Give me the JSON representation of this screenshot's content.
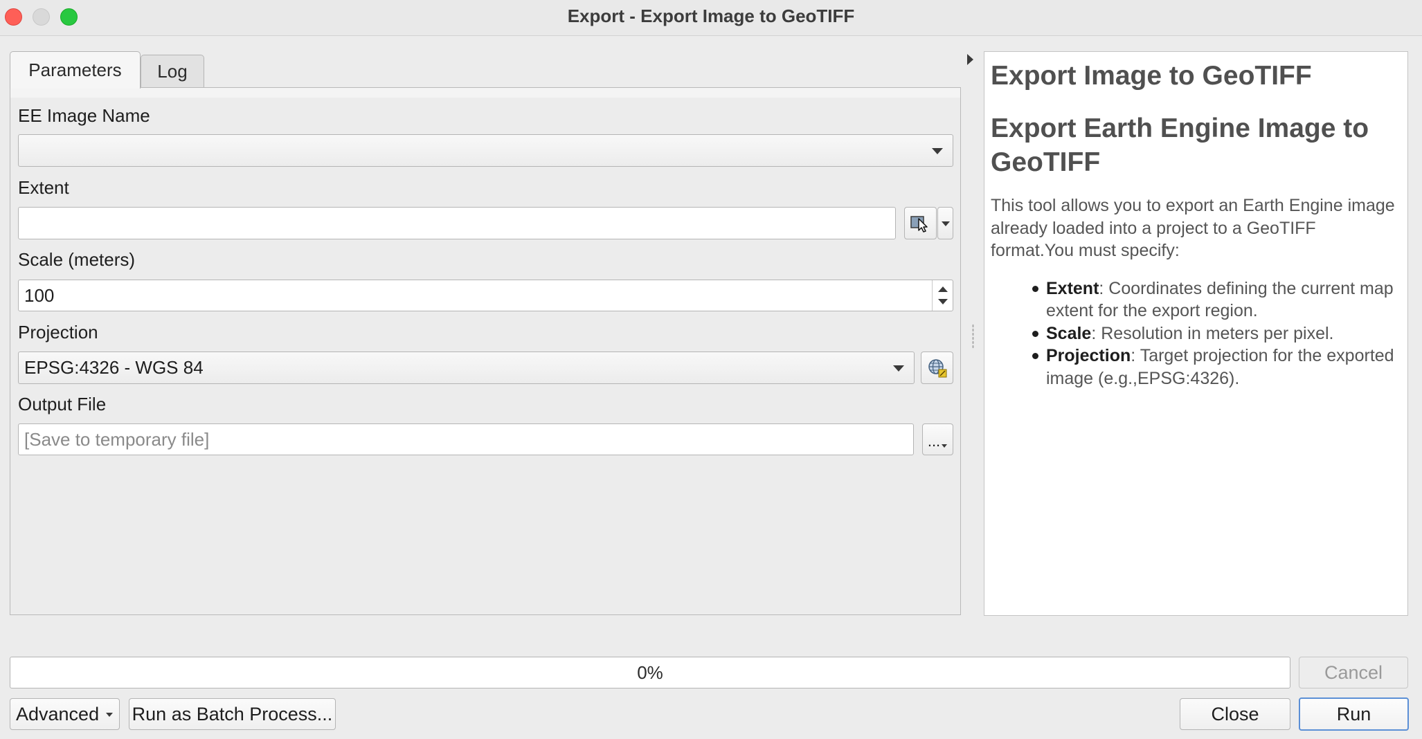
{
  "window": {
    "title": "Export - Export Image to GeoTIFF"
  },
  "tabs": [
    {
      "label": "Parameters",
      "active": true
    },
    {
      "label": "Log",
      "active": false
    }
  ],
  "params": {
    "ee_image_name": {
      "label": "EE Image Name",
      "value": ""
    },
    "extent": {
      "label": "Extent",
      "value": ""
    },
    "scale": {
      "label": "Scale (meters)",
      "value": "100"
    },
    "projection": {
      "label": "Projection",
      "value": "EPSG:4326 - WGS 84"
    },
    "output_file": {
      "label": "Output File",
      "placeholder": "[Save to temporary file]",
      "browse_label": "..."
    }
  },
  "help": {
    "title": "Export Image to GeoTIFF",
    "subtitle": "Export Earth Engine Image to GeoTIFF",
    "intro": "This tool allows you to export an Earth Engine image already loaded into a project to a GeoTIFF format.You must specify:",
    "items": [
      {
        "term": "Extent",
        "desc": ": Coordinates defining the current map extent for the export region."
      },
      {
        "term": "Scale",
        "desc": ": Resolution in meters per pixel."
      },
      {
        "term": "Projection",
        "desc": ": Target projection for the exported image (e.g.,EPSG:4326)."
      }
    ]
  },
  "progress": {
    "text": "0%",
    "value": 0
  },
  "buttons": {
    "cancel": "Cancel",
    "advanced": "Advanced",
    "batch": "Run as Batch Process...",
    "close": "Close",
    "run": "Run"
  },
  "colors": {
    "close_red": "#fe5f57",
    "zoom_green": "#28c840",
    "default_button_border": "#5b8fd6"
  }
}
